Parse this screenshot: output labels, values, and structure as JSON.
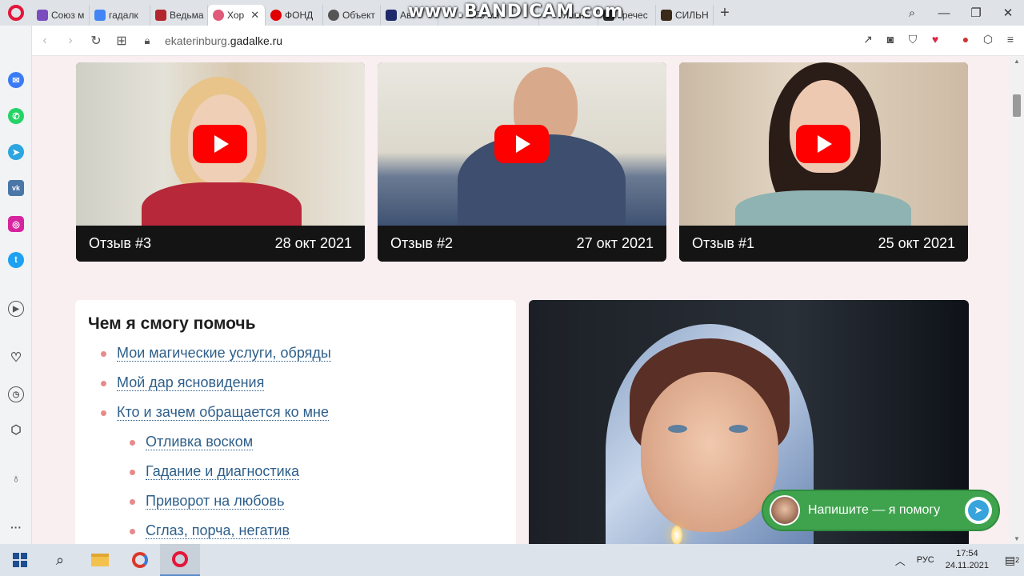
{
  "browser": {
    "tabs": [
      {
        "label": "Союз м",
        "favicon_color": "#7a4cc0",
        "active": false
      },
      {
        "label": "гадалк",
        "favicon_color": "#4285f4",
        "active": false
      },
      {
        "label": "Ведьма",
        "favicon_color": "#b3262d",
        "active": false
      },
      {
        "label": "Хор",
        "favicon_color": "#e05a7a",
        "active": true
      },
      {
        "label": "ФОНД",
        "favicon_color": "#e00000",
        "active": false
      },
      {
        "label": "Объект",
        "favicon_color": "#555555",
        "active": false
      },
      {
        "label": "Ав",
        "favicon_color": "#1f2a6b",
        "active": false
      },
      {
        "label": "обо мн",
        "favicon_color": "#cccccc",
        "active": false
      },
      {
        "label": "Главна",
        "favicon_color": "#cccccc",
        "active": false
      },
      {
        "label": "Гречес",
        "favicon_color": "#2b2b2b",
        "active": false
      },
      {
        "label": "СИЛЬН",
        "favicon_color": "#3a2a1a",
        "active": false
      }
    ],
    "new_tab": "+",
    "watermark": "www.BANDICAM.com",
    "url_domain": "ekaterinburg.",
    "url_host": "gadalke.ru"
  },
  "sidebar": {
    "icons": [
      "messenger-icon",
      "whatsapp-icon",
      "telegram-icon",
      "vk-icon",
      "instagram-icon",
      "twitter-icon",
      "player-icon",
      "heart-icon",
      "history-icon",
      "cube-icon",
      "bulb-icon",
      "more-icon"
    ]
  },
  "videos": [
    {
      "label": "Отзыв #3",
      "date": "28 окт 2021"
    },
    {
      "label": "Отзыв #2",
      "date": "27 окт 2021"
    },
    {
      "label": "Отзыв #1",
      "date": "25 окт 2021"
    }
  ],
  "help": {
    "title": "Чем я смогу помочь",
    "items": [
      {
        "text": "Мои магические услуги, обряды",
        "level": 1
      },
      {
        "text": "Мой дар ясновидения",
        "level": 1
      },
      {
        "text": "Кто и зачем обращается ко мне",
        "level": 1
      },
      {
        "text": "Отливка воском",
        "level": 2
      },
      {
        "text": "Гадание и диагностика",
        "level": 2
      },
      {
        "text": "Приворот на любовь",
        "level": 2
      },
      {
        "text": "Сглаз, порча, негатив",
        "level": 2
      }
    ]
  },
  "telegram_widget": {
    "text": "Напишите — я помогу",
    "color": "#3fa34d"
  },
  "taskbar": {
    "language": "РУС",
    "time": "17:54",
    "date": "24.11.2021",
    "notification_count": "2"
  }
}
